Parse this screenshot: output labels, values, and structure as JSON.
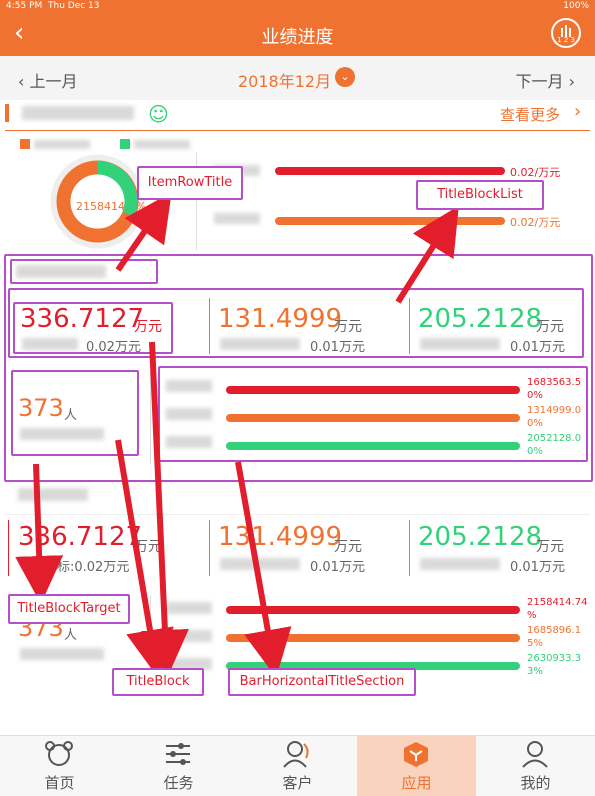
{
  "status_bar": {
    "time": "4:55 PM",
    "date": "Thu Dec 13",
    "battery": "100%"
  },
  "header": {
    "title": "业绩进度",
    "back_icon": "back-chevron-icon",
    "menu_icon": "calendar-123-icon",
    "menu_icon_text": "1 2 3"
  },
  "month_nav": {
    "prev_label": "‹ 上一月",
    "month": "2018年12月",
    "dropdown_icon": "chevron-down-icon",
    "next_label": "下一月 ›"
  },
  "summary": {
    "more_label": "查看更多",
    "more_icon": "chevron-right-icon",
    "smile_icon": "smile-icon",
    "donut_value": "2158414.",
    "donut_pct": "%",
    "row_bars": [
      {
        "value": "0.02/万元",
        "color": "#e21d2c"
      },
      {
        "value": "0.02/万元",
        "color": "#f07230"
      }
    ]
  },
  "section1": {
    "stats": [
      {
        "value": "336.7127",
        "unit": "万元",
        "sub": "0.02万元",
        "color": "#e21d2c"
      },
      {
        "value": "131.4999",
        "unit": "万元",
        "sub": "0.01万元",
        "color": "#f07230"
      },
      {
        "value": "205.2128",
        "unit": "万元",
        "sub": "0.01万元",
        "color": "#33d17a"
      }
    ],
    "people": {
      "value": "373",
      "unit": "人"
    },
    "bars": [
      {
        "label": "1683563.5\n0%",
        "color": "#e21d2c"
      },
      {
        "label": "1314999.0\n0%",
        "color": "#f07230"
      },
      {
        "label": "2052128.0\n0%",
        "color": "#33d17a"
      }
    ]
  },
  "section2": {
    "stats": [
      {
        "value": "336.7127",
        "unit": "万元",
        "sub": "目标:0.02万元",
        "color": "#e21d2c"
      },
      {
        "value": "131.4999",
        "unit": "万元",
        "sub": "0.01万元",
        "color": "#f07230"
      },
      {
        "value": "205.2128",
        "unit": "万元",
        "sub": "0.01万元",
        "color": "#33d17a"
      }
    ],
    "people": {
      "value": "373",
      "unit": "人"
    },
    "bars": [
      {
        "label": "2158414.74\n%",
        "color": "#e21d2c"
      },
      {
        "label": "1685896.1\n5%",
        "color": "#f07230"
      },
      {
        "label": "2630933.3\n3%",
        "color": "#33d17a"
      }
    ]
  },
  "annotations": {
    "item_row_title": "ItemRowTitle",
    "title_block_list": "TitleBlockList",
    "title_block_target": "TitleBlockTarget",
    "title_block": "TitleBlock",
    "bar_horizontal_title_section": "BarHorizontalTitleSection"
  },
  "tabs": [
    {
      "label": "首页",
      "icon": "bear-home-icon",
      "active": false
    },
    {
      "label": "任务",
      "icon": "sliders-task-icon",
      "active": false
    },
    {
      "label": "客户",
      "icon": "customer-person-icon",
      "active": false
    },
    {
      "label": "应用",
      "icon": "app-cube-icon",
      "active": true
    },
    {
      "label": "我的",
      "icon": "profile-person-icon",
      "active": false
    }
  ],
  "colors": {
    "accent": "#f07230",
    "red": "#e21d2c",
    "green": "#33d17a",
    "annotation": "#b54fc9"
  }
}
